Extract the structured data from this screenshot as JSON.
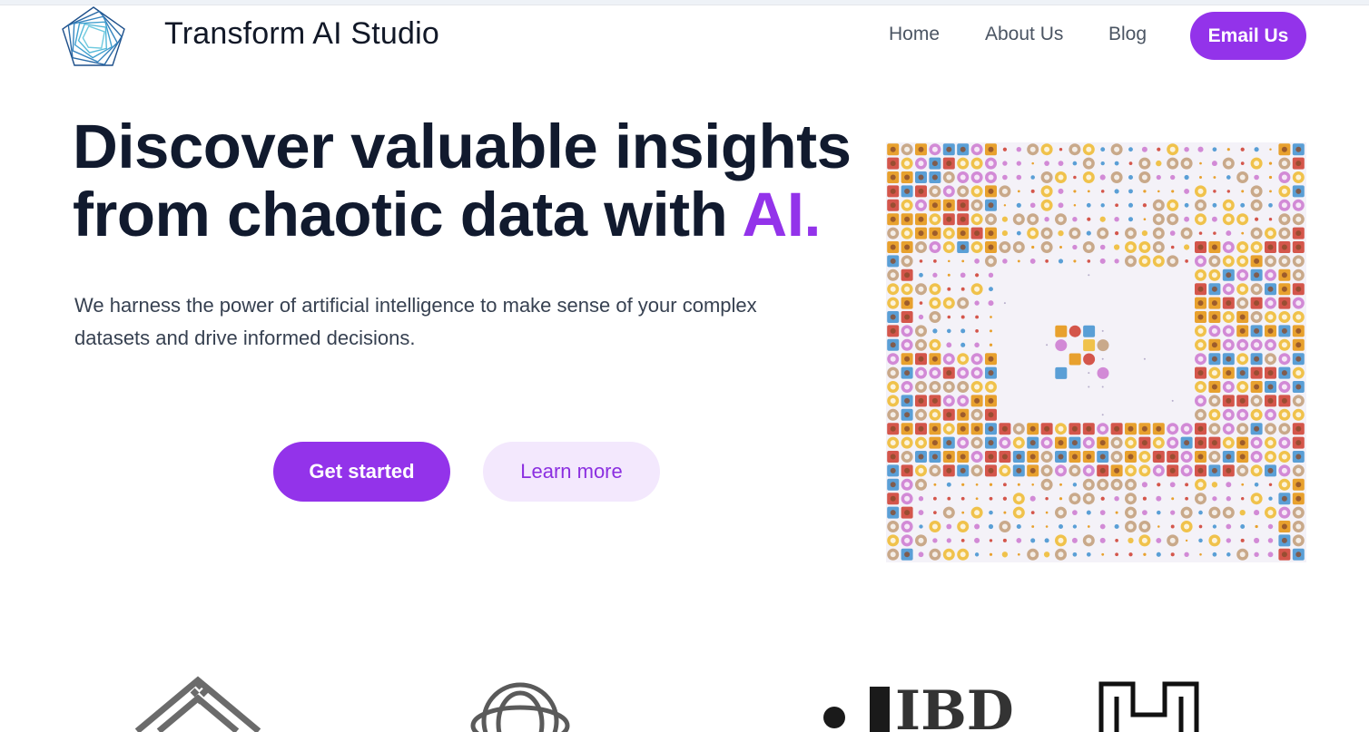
{
  "header": {
    "brand": "Transform AI Studio",
    "nav": [
      "Home",
      "About Us",
      "Blog"
    ],
    "cta": "Email Us"
  },
  "hero": {
    "title_line1": "Discover valuable insights",
    "title_line2_pre": "from chaotic data with ",
    "title_accent": "AI.",
    "subtitle": "We harness the power of artificial intelligence to make sense of your complex datasets and drive informed decisions.",
    "primary_button": "Get started",
    "secondary_button": "Learn more"
  },
  "clients": {
    "logo3_text": "IBD"
  },
  "colors": {
    "accent": "#9333ea",
    "accent_soft": "#f3e8fd",
    "heading": "#111a2e"
  },
  "icons": {
    "brand_logo": "pentagon-spiral-icon",
    "hero_image": "data-mosaic-illustration"
  }
}
